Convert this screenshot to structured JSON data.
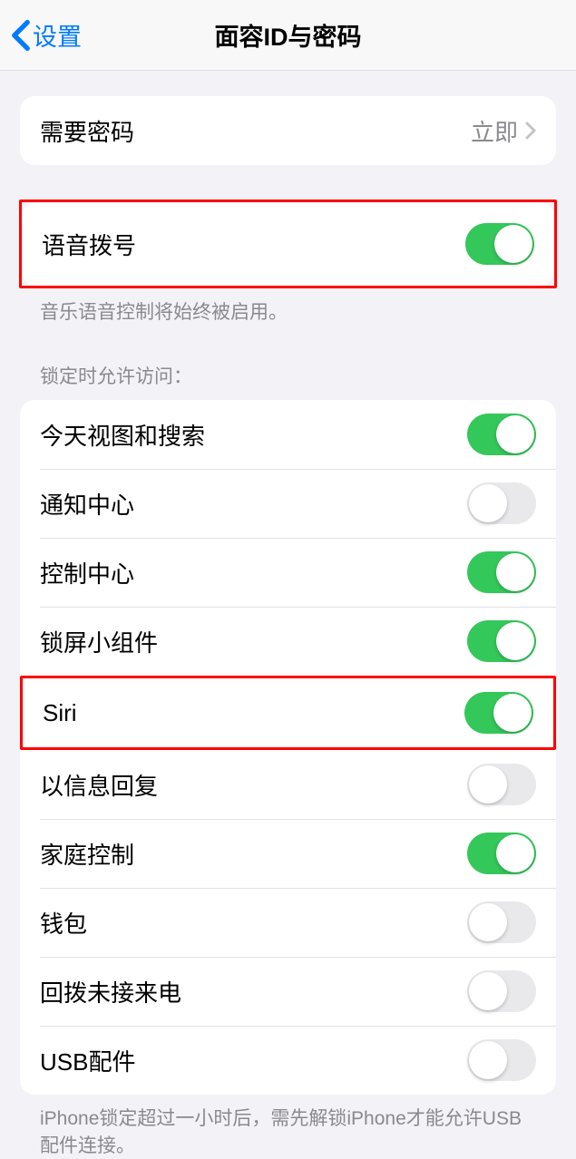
{
  "nav": {
    "back_label": "设置",
    "title": "面容ID与密码"
  },
  "passcode_section": {
    "require_label": "需要密码",
    "require_value": "立即"
  },
  "voice_dial": {
    "label": "语音拨号",
    "enabled": true,
    "footer": "音乐语音控制将始终被启用。"
  },
  "lock_access": {
    "header": "锁定时允许访问：",
    "items": [
      {
        "label": "今天视图和搜索",
        "enabled": true
      },
      {
        "label": "通知中心",
        "enabled": false
      },
      {
        "label": "控制中心",
        "enabled": true
      },
      {
        "label": "锁屏小组件",
        "enabled": true
      },
      {
        "label": "Siri",
        "enabled": true
      },
      {
        "label": "以信息回复",
        "enabled": false
      },
      {
        "label": "家庭控制",
        "enabled": true
      },
      {
        "label": "钱包",
        "enabled": false
      },
      {
        "label": "回拨未接来电",
        "enabled": false
      },
      {
        "label": "USB配件",
        "enabled": false
      }
    ],
    "footer": "iPhone锁定超过一小时后，需先解锁iPhone才能允许USB配件连接。"
  },
  "highlighted_rows": [
    0,
    5
  ]
}
